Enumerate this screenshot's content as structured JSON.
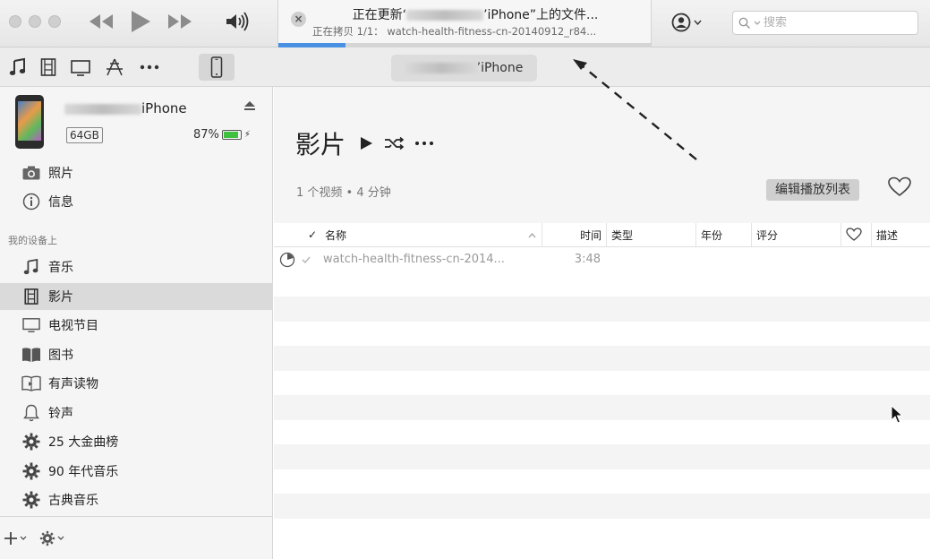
{
  "toolbar": {
    "lcd_title_prefix": "正在更新‘",
    "lcd_title_suffix": "’iPhone”上的文件...",
    "lcd_subtitle": "正在拷贝 1/1： watch-health-fitness-cn-20140912_r84...",
    "progress_percent": 18,
    "search_placeholder": "搜索"
  },
  "navbar": {
    "device_label": "’iPhone"
  },
  "sidebar": {
    "device": {
      "name_suffix": "iPhone",
      "capacity": "64GB",
      "battery_percent": "87%",
      "battery_level": 0.87
    },
    "library_items": [
      {
        "label": "照片",
        "icon": "camera-icon"
      },
      {
        "label": "信息",
        "icon": "info-icon"
      }
    ],
    "section_title": "我的设备上",
    "device_items": [
      {
        "label": "音乐",
        "icon": "music-note-icon"
      },
      {
        "label": "影片",
        "icon": "film-icon",
        "selected": true
      },
      {
        "label": "电视节目",
        "icon": "tv-icon"
      },
      {
        "label": "图书",
        "icon": "book-icon"
      },
      {
        "label": "有声读物",
        "icon": "audiobook-icon"
      },
      {
        "label": "铃声",
        "icon": "bell-icon"
      },
      {
        "label": "25 大金曲榜",
        "icon": "gear-icon"
      },
      {
        "label": "90 年代音乐",
        "icon": "gear-icon"
      },
      {
        "label": "古典音乐",
        "icon": "gear-icon"
      }
    ]
  },
  "main": {
    "title": "影片",
    "meta": "1 个视频 • 4 分钟",
    "edit_playlist_label": "编辑播放列表",
    "columns": {
      "check": "✓",
      "name": "名称",
      "time": "时间",
      "type": "类型",
      "year": "年份",
      "rating": "评分",
      "description": "描述"
    },
    "rows": [
      {
        "name": "watch-health-fitness-cn-2014...",
        "time": "3:48"
      }
    ]
  },
  "colors": {
    "accent": "#4a90e2",
    "battery": "#3fc13f"
  }
}
